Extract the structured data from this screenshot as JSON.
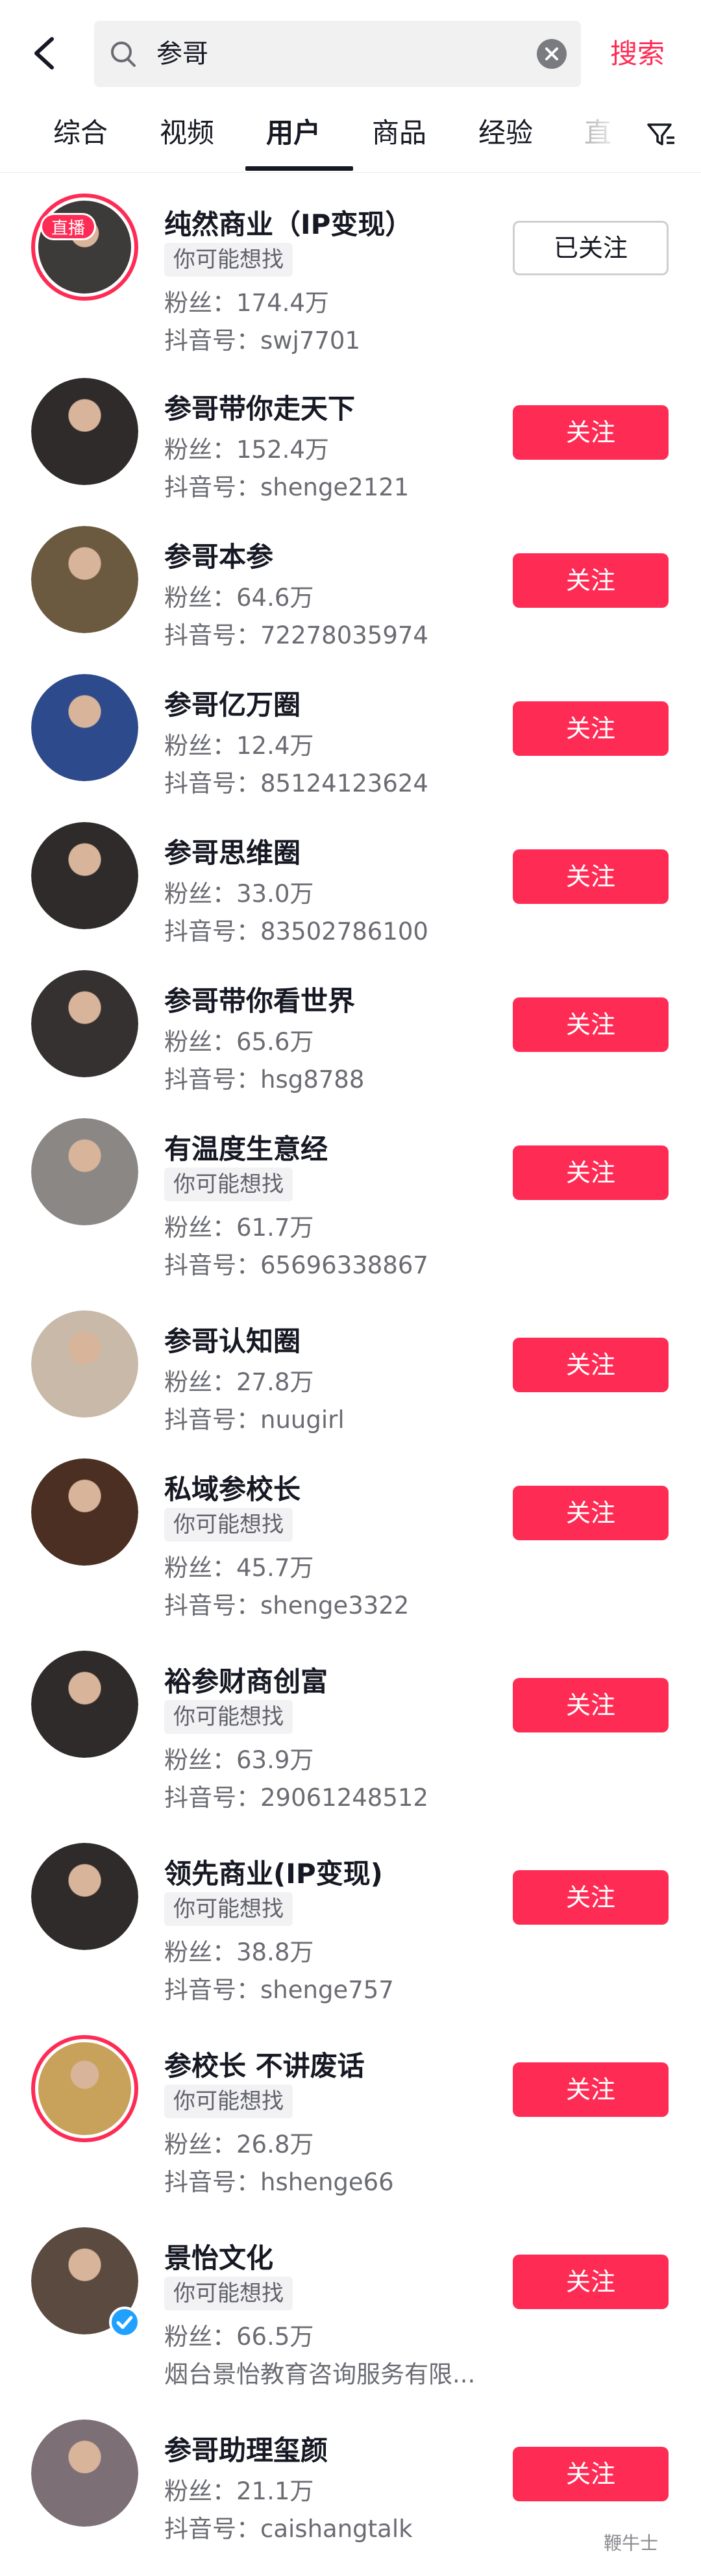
{
  "header": {
    "search_value": "参哥",
    "search_button": "搜索"
  },
  "tabs": [
    {
      "label": "综合"
    },
    {
      "label": "视频"
    },
    {
      "label": "用户",
      "active": true
    },
    {
      "label": "商品"
    },
    {
      "label": "经验"
    },
    {
      "label": "直"
    }
  ],
  "users": [
    {
      "name": "纯然商业（IP变现）",
      "live_badge": "直播",
      "tag": "你可能想找",
      "fans": "粉丝：174.4万",
      "id": "抖音号：swj7701",
      "button": "已关注",
      "followed": true,
      "avatar_bg": "#3d3a3a"
    },
    {
      "name": "参哥带你走天下",
      "fans": "粉丝：152.4万",
      "id": "抖音号：shenge2121",
      "button": "关注",
      "avatar_bg": "#2f2b2b"
    },
    {
      "name": "参哥本参",
      "fans": "粉丝：64.6万",
      "id": "抖音号：72278035974",
      "button": "关注",
      "avatar_bg": "#6b5a3f"
    },
    {
      "name": "参哥亿万圈",
      "fans": "粉丝：12.4万",
      "id": "抖音号：85124123624",
      "button": "关注",
      "avatar_bg": "#2d4b8c"
    },
    {
      "name": "参哥思维圈",
      "fans": "粉丝：33.0万",
      "id": "抖音号：83502786100",
      "button": "关注",
      "avatar_bg": "#2f2b2b"
    },
    {
      "name": "参哥带你看世界",
      "fans": "粉丝：65.6万",
      "id": "抖音号：hsg8788",
      "button": "关注",
      "avatar_bg": "#363131"
    },
    {
      "name": "有温度生意经",
      "tag": "你可能想找",
      "fans": "粉丝：61.7万",
      "id": "抖音号：65696338867",
      "button": "关注",
      "avatar_bg": "#8a8785"
    },
    {
      "name": "参哥认知圈",
      "fans": "粉丝：27.8万",
      "id": "抖音号：nuugirl",
      "button": "关注",
      "avatar_bg": "#c9b9a8"
    },
    {
      "name": "私域参校长",
      "tag": "你可能想找",
      "fans": "粉丝：45.7万",
      "id": "抖音号：shenge3322",
      "button": "关注",
      "avatar_bg": "#4a2f22"
    },
    {
      "name": "裕参财商创富",
      "tag": "你可能想找",
      "fans": "粉丝：63.9万",
      "id": "抖音号：29061248512",
      "button": "关注",
      "avatar_bg": "#2f2b2b"
    },
    {
      "name": "领先商业(IP变现)",
      "tag": "你可能想找",
      "fans": "粉丝：38.8万",
      "id": "抖音号：shenge757",
      "button": "关注",
      "avatar_bg": "#2f2b2b"
    },
    {
      "name": "参校长 不讲废话",
      "tag": "你可能想找",
      "fans": "粉丝：26.8万",
      "id": "抖音号：hshenge66",
      "button": "关注",
      "avatar_bg": "#c8a25a",
      "ring": true
    },
    {
      "name": "景怡文化",
      "tag": "你可能想找",
      "fans": "粉丝：66.5万",
      "id": "烟台景怡教育咨询服务有限...",
      "button": "关注",
      "avatar_bg": "#5b4a3f",
      "verified": true
    },
    {
      "name": "参哥助理玺颜",
      "fans": "粉丝：21.1万",
      "id": "抖音号：caishangtalk",
      "button": "关注",
      "avatar_bg": "#7c6f75"
    }
  ],
  "watermark": "鞭牛士"
}
